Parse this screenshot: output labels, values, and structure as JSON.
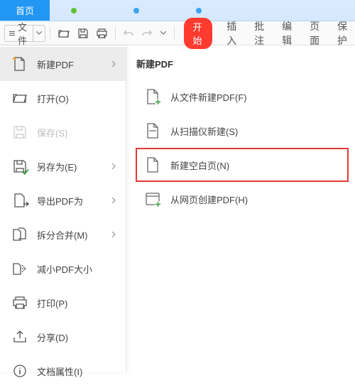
{
  "titlebar": {
    "tabs": [
      {
        "label": "首页",
        "active": true
      },
      {
        "label": "",
        "active": false
      },
      {
        "label": "",
        "active": false
      },
      {
        "label": "",
        "active": false
      }
    ]
  },
  "toolbar": {
    "file_label": "文件",
    "tabs": {
      "start": "开始",
      "insert": "插入",
      "comment": "批注",
      "edit": "编辑",
      "page": "页面",
      "protect": "保护"
    }
  },
  "file_menu": {
    "items": [
      {
        "label": "新建PDF",
        "has_submenu": true,
        "active": true,
        "disabled": false
      },
      {
        "label": "打开(O)",
        "has_submenu": false,
        "active": false,
        "disabled": false
      },
      {
        "label": "保存(S)",
        "has_submenu": false,
        "active": false,
        "disabled": true
      },
      {
        "label": "另存为(E)",
        "has_submenu": true,
        "active": false,
        "disabled": false
      },
      {
        "label": "导出PDF为",
        "has_submenu": true,
        "active": false,
        "disabled": false
      },
      {
        "label": "拆分合并(M)",
        "has_submenu": true,
        "active": false,
        "disabled": false
      },
      {
        "label": "减小PDF大小",
        "has_submenu": false,
        "active": false,
        "disabled": false
      },
      {
        "label": "打印(P)",
        "has_submenu": false,
        "active": false,
        "disabled": false
      },
      {
        "label": "分享(D)",
        "has_submenu": false,
        "active": false,
        "disabled": false
      },
      {
        "label": "文档属性(I)",
        "has_submenu": false,
        "active": false,
        "disabled": false
      }
    ]
  },
  "submenu": {
    "title": "新建PDF",
    "items": [
      {
        "label": "从文件新建PDF(F)",
        "highlight": false
      },
      {
        "label": "从扫描仪新建(S)",
        "highlight": false
      },
      {
        "label": "新建空白页(N)",
        "highlight": true
      },
      {
        "label": "从网页创建PDF(H)",
        "highlight": false
      }
    ]
  }
}
